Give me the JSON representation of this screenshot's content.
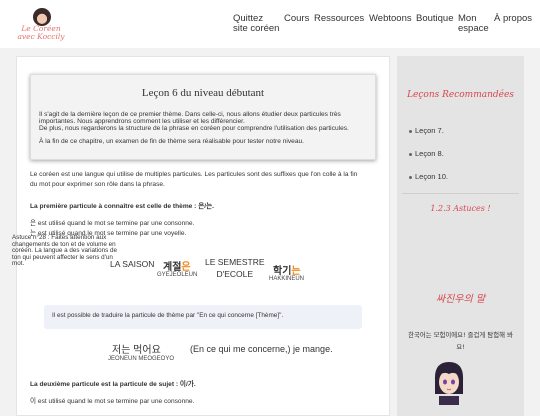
{
  "logo": {
    "line1": "Le Coréen",
    "line2": "avec Koccily"
  },
  "nav": {
    "quittez_line1": "Quittez",
    "quittez_line2": "site coréen",
    "cours": "Cours",
    "ressources": "Ressources",
    "webtoons": "Webtoons",
    "boutique": "Boutique",
    "mon_espace_line1": "Mon",
    "mon_espace_line2": "espace",
    "a_propos": "À propos"
  },
  "lesson": {
    "title": "Leçon 6 du niveau débutant",
    "intro_1": "Il s'agit de la dernière leçon de ce premier thème. Dans celle-ci, nous allons étudier deux particules très importantes. Nous apprendrons comment les utiliser et les différencier.",
    "intro_2": "De plus, nous regarderons la structure de la phrase en coréen pour comprendre l'utilisation des particules.",
    "intro_3": "À la fin de ce chapitre, un examen de fin de thème sera réalisable pour tester notre niveau."
  },
  "content": {
    "p1_line1": "Le coréen est une langue qui utilise de multiples particules. Les particules sont des suffixes que l'on colle à la fin",
    "p1_line2": "du mot pour exprimer son rôle dans la phrase.",
    "first_particle_heading": "La première particule à connaître est celle de thème : 은/는.",
    "rule_1": "은 est utilisé quand le mot se termine par une consonne.",
    "rule_2": "는 est utilisé quand le mot se termine par une voyelle.",
    "ex1_fr": "LA SAISON",
    "ex1_kr_stem": "계절",
    "ex1_kr_particle": "은",
    "ex1_romanization": "GYEJEOLEUN",
    "ex2_fr_line1": "LE SEMESTRE",
    "ex2_fr_line2": "D'ECOLE",
    "ex2_kr_stem": "학기",
    "ex2_kr_particle": "는",
    "ex2_romanization": "HAKKINEUN",
    "note": "Il est possible de traduire la particule de thème par \"En ce qui concerne [Thème]\".",
    "ex3_kr": "저는 먹어요",
    "ex3_romanization": "JEONEUN MEOGEOYO",
    "ex3_translation": "(En ce qui me concerne,) je mange.",
    "second_particle_heading": "La deuxième particule est la particule de sujet : 이/가.",
    "rule_3": "이 est utilisé quand le mot se termine par une consonne."
  },
  "sidebar": {
    "recommended_heading": "Leçons Recommandées",
    "recommended_items": [
      "Leçon 7.",
      "Leçon 8.",
      "Leçon 10."
    ],
    "tips_heading": "1.2.3 Astuces !",
    "tip_text": "Astuce n°28 : Faites attention aux changements de ton et de volume en coréen. La langue a des variations de ton qui peuvent affecter le sens d'un mot.",
    "kr_heading": "싸진우의 말",
    "kr_text": "한국어는 모험이에요! 즐겁게 탐험해 봐요!"
  },
  "colors": {
    "accent": "#d7474e",
    "particle": "#f28a1c",
    "note_bg": "#eef1f7",
    "sidebar_bg": "#e4e4e4"
  }
}
